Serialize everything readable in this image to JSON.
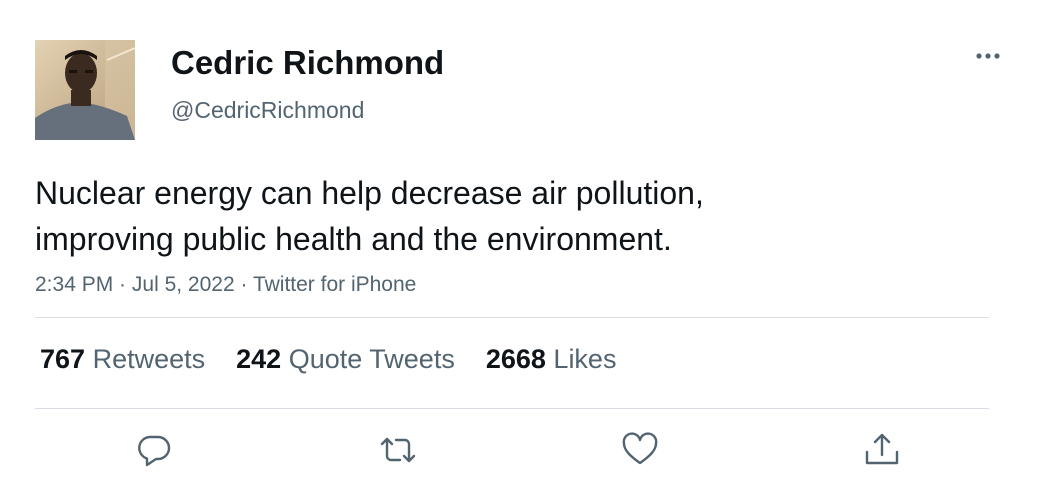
{
  "author": {
    "display_name": "Cedric Richmond",
    "handle": "@CedricRichmond"
  },
  "tweet": {
    "lines": [
      "Nuclear energy can help decrease air pollution,",
      "improving public health and the environment."
    ]
  },
  "meta": {
    "time": "2:34 PM",
    "separator": " · ",
    "date": "Jul 5, 2022",
    "source": "Twitter for iPhone"
  },
  "stats": {
    "retweets": {
      "count": "767",
      "label": "Retweets"
    },
    "quotes": {
      "count": "242",
      "label": "Quote Tweets"
    },
    "likes": {
      "count": "2668",
      "label": "Likes"
    }
  },
  "icons": {
    "more": "more-horizontal-icon",
    "reply": "reply-icon",
    "retweet": "retweet-icon",
    "like": "heart-icon",
    "share": "share-icon"
  },
  "colors": {
    "text_primary": "#0f1419",
    "text_secondary": "#536471",
    "divider": "#d7dde2"
  }
}
